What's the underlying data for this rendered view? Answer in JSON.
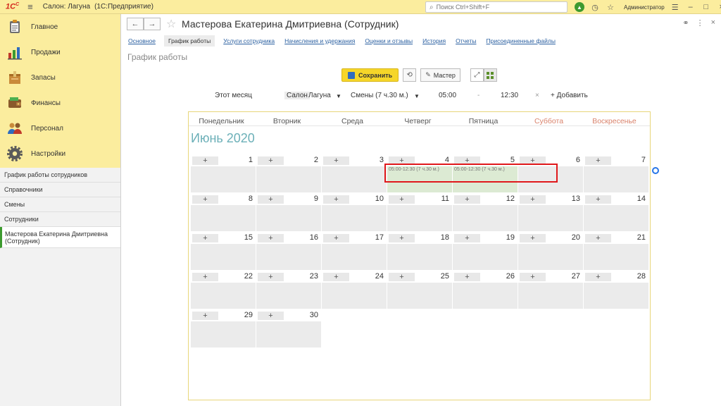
{
  "topbar": {
    "logo": "1С",
    "title": "Салон: Лагуна",
    "enterprise": "(1С:Предприятие)",
    "search_placeholder": "Поиск Ctrl+Shift+F",
    "user": "Администратор"
  },
  "sidebar": {
    "sections": [
      {
        "label": "Главное",
        "icon": "clipboard-icon"
      },
      {
        "label": "Продажи",
        "icon": "bar-chart-icon"
      },
      {
        "label": "Запасы",
        "icon": "box-icon"
      },
      {
        "label": "Финансы",
        "icon": "wallet-icon"
      },
      {
        "label": "Персонал",
        "icon": "people-icon"
      },
      {
        "label": "Настройки",
        "icon": "gear-icon"
      }
    ],
    "items": [
      {
        "label": "График работы сотрудников"
      },
      {
        "label": "Справочники"
      },
      {
        "label": "Смены"
      },
      {
        "label": "Сотрудники"
      },
      {
        "label": "Мастерова Екатерина Дмитриевна (Сотрудник)"
      }
    ]
  },
  "main": {
    "title": "Мастерова Екатерина Дмитриевна (Сотрудник)",
    "tabs": [
      {
        "label": "Основное"
      },
      {
        "label": "График работы"
      },
      {
        "label": "Услуги сотрудника"
      },
      {
        "label": "Начисления и удержания"
      },
      {
        "label": "Оценки и отзывы"
      },
      {
        "label": "История"
      },
      {
        "label": "Отчеты"
      },
      {
        "label": "Присоединенные файлы"
      }
    ],
    "subtitle": "График работы",
    "toolbar": {
      "save_label": "Сохранить",
      "master_label": "Мастер"
    },
    "filters": {
      "month": "Этот месяц",
      "salon_label": "Салон",
      "salon_value": "Лагуна",
      "shift": "Смены (7 ч.30 м.)",
      "from": "05:00",
      "dash": "-",
      "to": "12:30",
      "clear": "×",
      "add": "+ Добавить"
    }
  },
  "calendar": {
    "weekdays": [
      "Понедельник",
      "Вторник",
      "Среда",
      "Четверг",
      "Пятница",
      "Суббота",
      "Воскресенье"
    ],
    "month_title": "Июнь 2020",
    "plus": "+",
    "shift_label": "05:00-12:30 (7 ч.30 м.)",
    "days": [
      1,
      2,
      3,
      4,
      5,
      6,
      7,
      8,
      9,
      10,
      11,
      12,
      13,
      14,
      15,
      16,
      17,
      18,
      19,
      20,
      21,
      22,
      23,
      24,
      25,
      26,
      27,
      28,
      29,
      30
    ],
    "scheduled_days": [
      4,
      5
    ]
  }
}
